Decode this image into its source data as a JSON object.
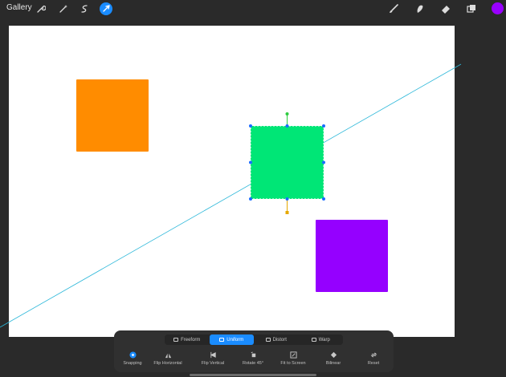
{
  "topbar": {
    "gallery_label": "Gallery",
    "left_tools": [
      {
        "name": "wrench-icon"
      },
      {
        "name": "magic-wand-icon"
      },
      {
        "name": "selection-icon"
      },
      {
        "name": "transform-arrow-icon",
        "active": true
      }
    ],
    "right_tools": [
      {
        "name": "brush-icon"
      },
      {
        "name": "smudge-icon"
      },
      {
        "name": "eraser-icon"
      },
      {
        "name": "layers-icon"
      }
    ],
    "current_color": "#9900ff"
  },
  "canvas": {
    "background": "#ffffff",
    "shapes": [
      {
        "name": "orange-square",
        "color": "#ff8c00"
      },
      {
        "name": "green-square",
        "color": "#00e676",
        "selected": true
      },
      {
        "name": "purple-square",
        "color": "#9500ff"
      }
    ],
    "guide_color": "#2ab7d9"
  },
  "transform_panel": {
    "modes": [
      {
        "label": "Freeform",
        "active": false
      },
      {
        "label": "Uniform",
        "active": true
      },
      {
        "label": "Distort",
        "active": false
      },
      {
        "label": "Warp",
        "active": false
      }
    ],
    "actions": [
      {
        "label": "Snapping",
        "icon": "snapping-icon",
        "active": true
      },
      {
        "label": "Flip Horizontal",
        "icon": "flip-horizontal-icon"
      },
      {
        "label": "Flip Vertical",
        "icon": "flip-vertical-icon"
      },
      {
        "label": "Rotate 45°",
        "icon": "rotate-icon"
      },
      {
        "label": "Fit to Screen",
        "icon": "fit-to-screen-icon"
      },
      {
        "label": "Bilinear",
        "icon": "bilinear-icon"
      },
      {
        "label": "Reset",
        "icon": "reset-icon"
      }
    ]
  }
}
